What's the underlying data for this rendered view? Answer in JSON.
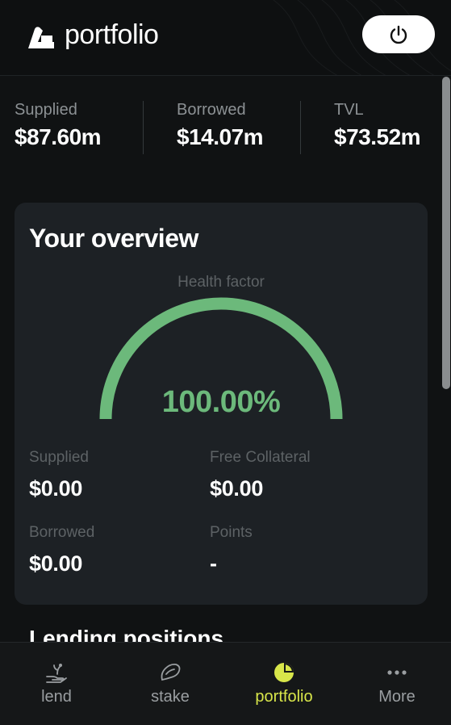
{
  "header": {
    "brand": "portfolio",
    "logo_icon": "bera-logo-icon",
    "power_icon": "power-icon"
  },
  "stats": [
    {
      "label": "Supplied",
      "value": "$87.60m"
    },
    {
      "label": "Borrowed",
      "value": "$14.07m"
    },
    {
      "label": "TVL",
      "value": "$73.52m"
    }
  ],
  "overview": {
    "title": "Your overview",
    "health_factor_label": "Health factor",
    "health_factor_value": "100.00%",
    "health_factor_fraction": 1.0,
    "gauge_color": "#6cb97b",
    "items": [
      {
        "label": "Supplied",
        "value": "$0.00"
      },
      {
        "label": "Free Collateral",
        "value": "$0.00"
      },
      {
        "label": "Borrowed",
        "value": "$0.00"
      },
      {
        "label": "Points",
        "value": "-"
      }
    ]
  },
  "section_title": "Lending positions",
  "nav": [
    {
      "label": "lend",
      "icon": "lend-icon",
      "active": false
    },
    {
      "label": "stake",
      "icon": "stake-icon",
      "active": false
    },
    {
      "label": "portfolio",
      "icon": "pie-chart-icon",
      "active": true
    },
    {
      "label": "More",
      "icon": "more-dots-icon",
      "active": false
    }
  ],
  "colors": {
    "accent": "#d8e64a",
    "health": "#6cb97b",
    "background": "#101213",
    "card": "#1d2125"
  }
}
